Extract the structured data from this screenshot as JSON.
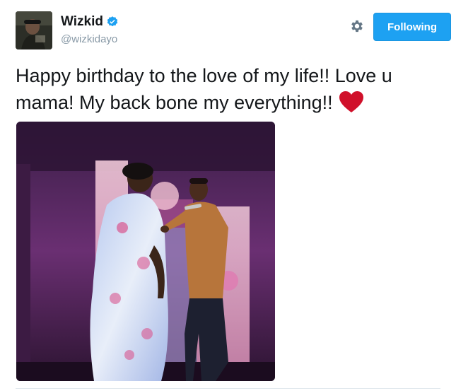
{
  "tweet": {
    "author": {
      "display_name": "Wizkid",
      "handle": "@wizkidayo",
      "verified": true,
      "avatar_icon": "avatar-photo"
    },
    "follow_button_label": "Following",
    "settings_icon": "gear-icon",
    "text": "Happy birthday to the love of my life!! Love u mama! My back bone my everything!!",
    "emoji_icon": "red-heart-icon",
    "media": {
      "type": "photo"
    }
  },
  "colors": {
    "accent": "#1da1f2",
    "heart": "#d0102a",
    "handle_gray": "#8899a6",
    "text": "#14171a"
  }
}
